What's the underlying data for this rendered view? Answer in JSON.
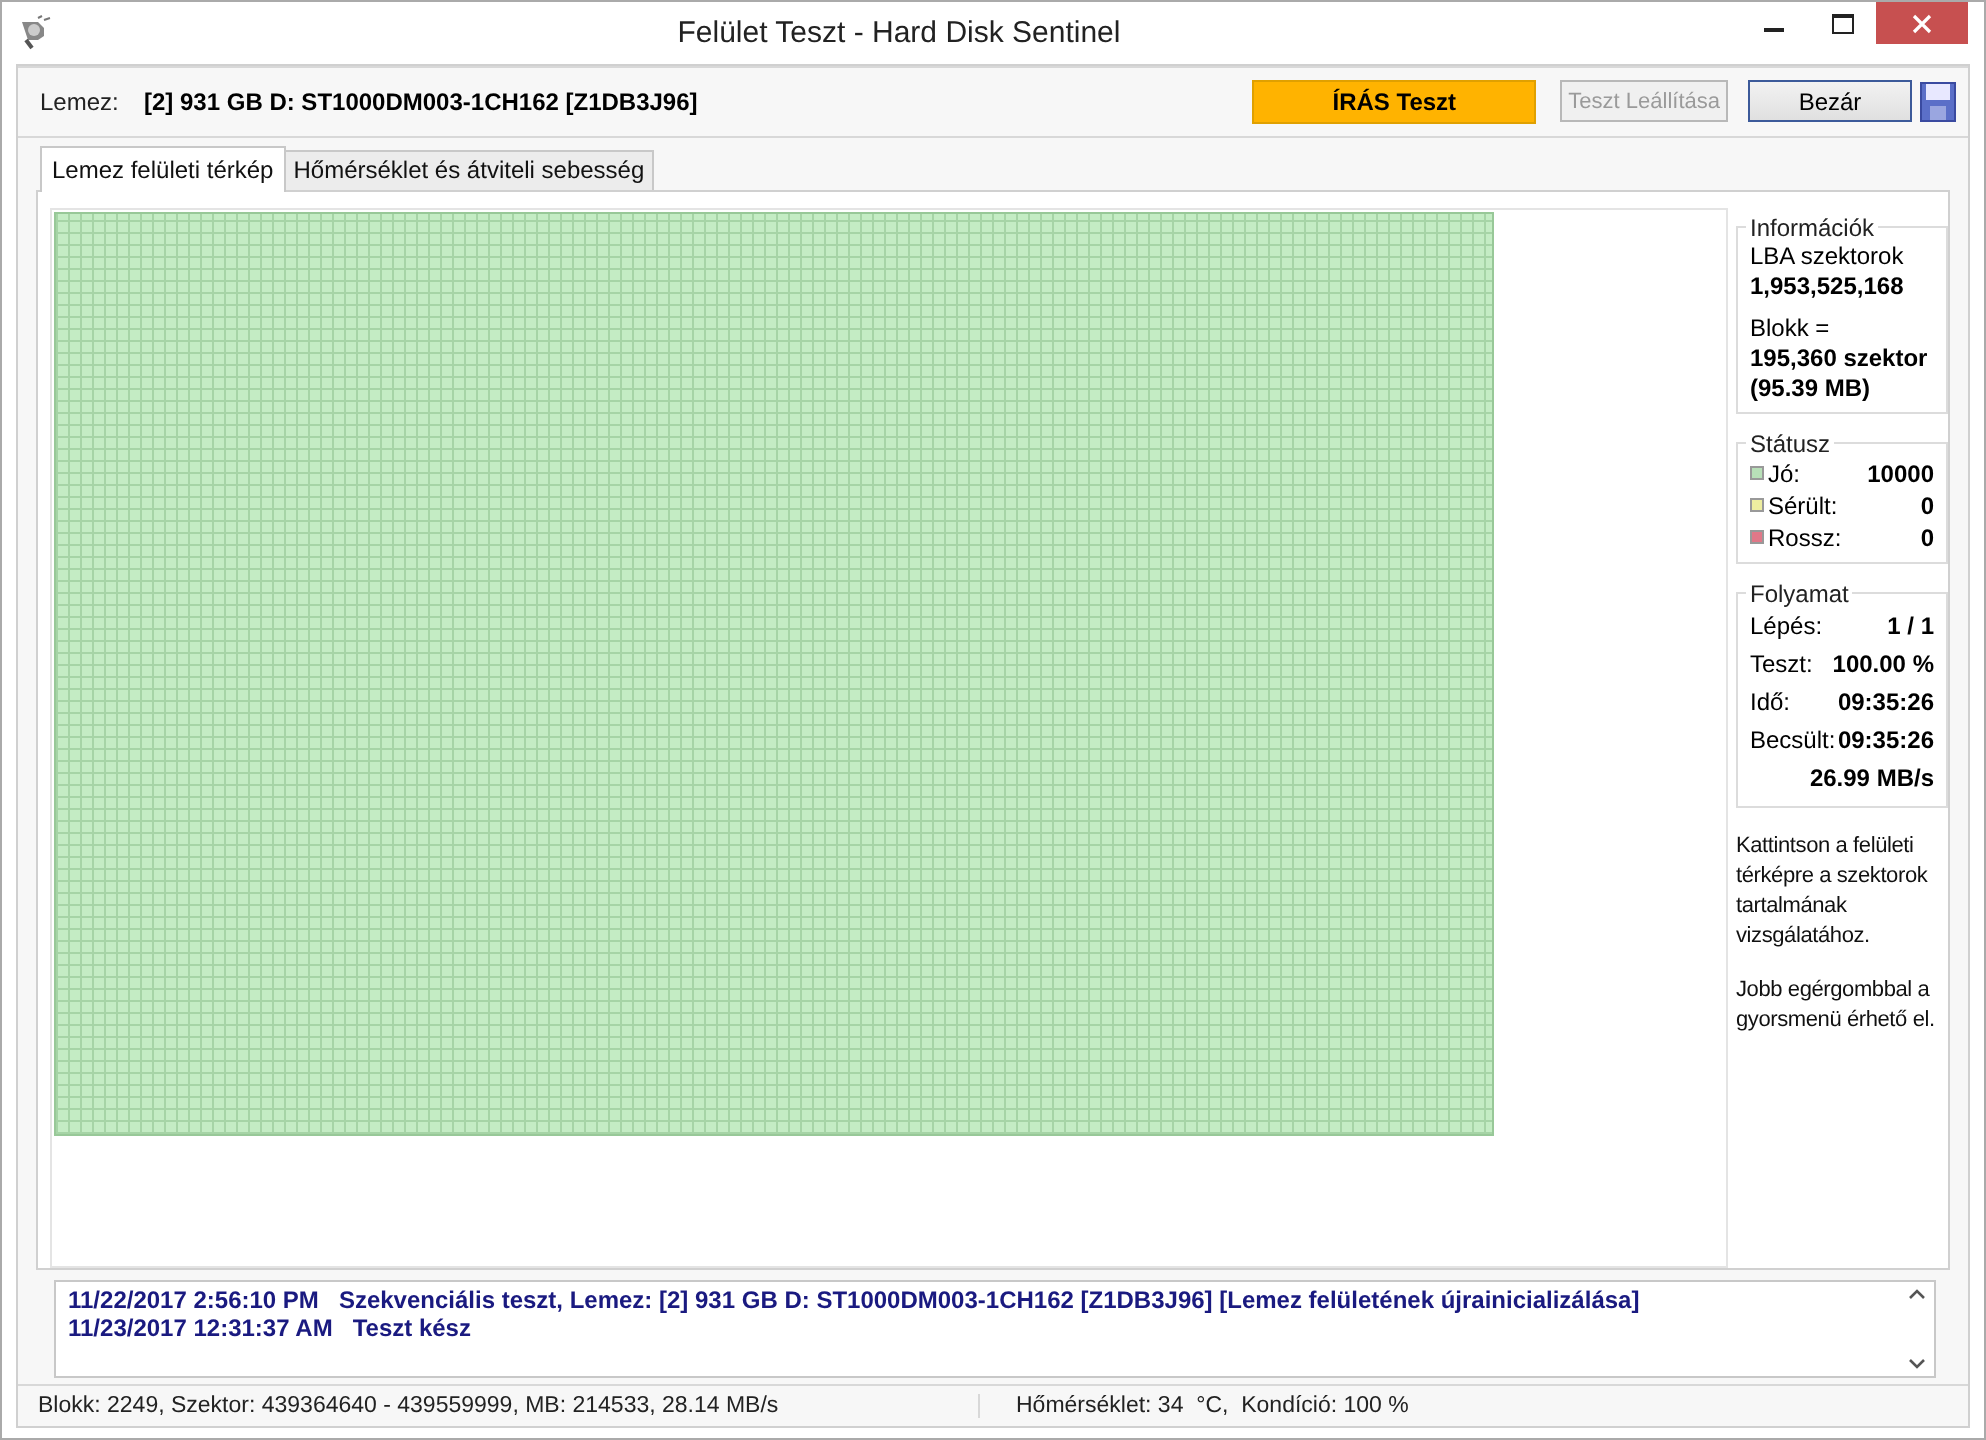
{
  "window": {
    "title": "Felület Teszt - Hard Disk Sentinel"
  },
  "toolbar": {
    "disk_label": "Lemez:",
    "disk_value": "[2] 931 GB D: ST1000DM003-1CH162 [Z1DB3J96]",
    "test_mode": "ÍRÁS Teszt",
    "buttons": [
      {
        "label": "Teszt Leállítása",
        "disabled": true
      },
      {
        "label": "Bezár",
        "disabled": false
      }
    ]
  },
  "tabs": [
    {
      "label": "Lemez felületi térkép",
      "selected": true
    },
    {
      "label": "Hőmérséklet és átviteli sebesség",
      "selected": false
    }
  ],
  "info": {
    "title": "Információk",
    "lba_label": "LBA szektorok",
    "lba_value": "1,953,525,168",
    "block_label": "Blokk =",
    "block_value": "195,360 szektor",
    "block_size": "(95.39 MB)"
  },
  "status": {
    "title": "Státusz",
    "items": [
      {
        "label": "Jó:",
        "value": "10000",
        "color": "#b8e0b8"
      },
      {
        "label": "Sérült:",
        "value": "0",
        "color": "#eeeea0"
      },
      {
        "label": "Rossz:",
        "value": "0",
        "color": "#e07888"
      }
    ]
  },
  "progress": {
    "title": "Folyamat",
    "rows": [
      {
        "label": "Lépés:",
        "value": "1 / 1"
      },
      {
        "label": "Teszt:",
        "value": "100.00 %"
      },
      {
        "label": "Idő:",
        "value": "09:35:26"
      },
      {
        "label": "Becsült:",
        "value": "09:35:26"
      }
    ],
    "speed": "26.99 MB/s"
  },
  "hints": [
    "Kattintson a felületi térképre a szektorok tartalmának vizsgálatához.",
    "Jobb egérgombbal a gyorsmenü érhető el."
  ],
  "log": [
    {
      "timestamp": "11/22/2017  2:56:10 PM",
      "message": "Szekvenciális teszt, Lemez: [2] 931 GB D: ST1000DM003-1CH162 [Z1DB3J96] [Lemez felületének újrainicializálása]"
    },
    {
      "timestamp": "11/23/2017  12:31:37 AM",
      "message": "Teszt kész"
    }
  ],
  "status_bar": {
    "left": "Blokk: 2249, Szektor: 439364640 - 439559999, MB: 214533, 28.14 MB/s",
    "right": "Hőmérséklet: 34  °C,  Kondíció: 100 %"
  }
}
